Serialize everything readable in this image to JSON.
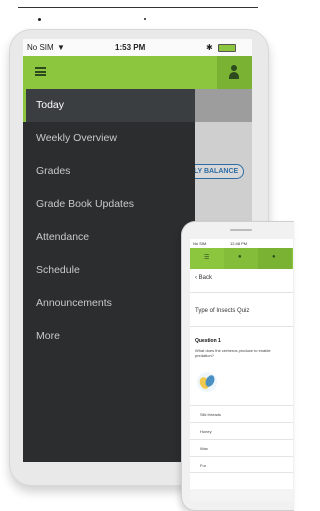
{
  "tablet": {
    "status_bar": {
      "carrier": "No SIM",
      "wifi_icon": "wifi-icon",
      "time": "1:53 PM",
      "battery_icon": "battery-icon"
    },
    "header": {
      "menu_icon": "hamburger-icon",
      "profile_icon": "person-icon",
      "accent_color": "#8cc63f"
    },
    "background_button": "LY BALANCE",
    "drawer": {
      "items": [
        {
          "label": "Today",
          "selected": true
        },
        {
          "label": "Weekly Overview",
          "selected": false
        },
        {
          "label": "Grades",
          "selected": false
        },
        {
          "label": "Grade Book Updates",
          "selected": false
        },
        {
          "label": "Attendance",
          "selected": false
        },
        {
          "label": "Schedule",
          "selected": false
        },
        {
          "label": "Announcements",
          "selected": false
        },
        {
          "label": "More",
          "selected": false
        }
      ],
      "background_color": "#2b2d2f"
    }
  },
  "phone": {
    "status_bar": {
      "carrier": "No SIM",
      "time": "12:48 PM"
    },
    "header": {
      "icons": [
        "hamburger-icon",
        "person-icon",
        "person-icon"
      ]
    },
    "back_label": "Back",
    "quiz_title": "Type of Insects Quiz",
    "question": {
      "heading": "Question 1",
      "text": "What does the cerberus produce to enable predation?",
      "image_icon": "insect-illustration",
      "options": [
        "Silk threads",
        "Honey",
        "Wax",
        "Fur"
      ]
    }
  }
}
